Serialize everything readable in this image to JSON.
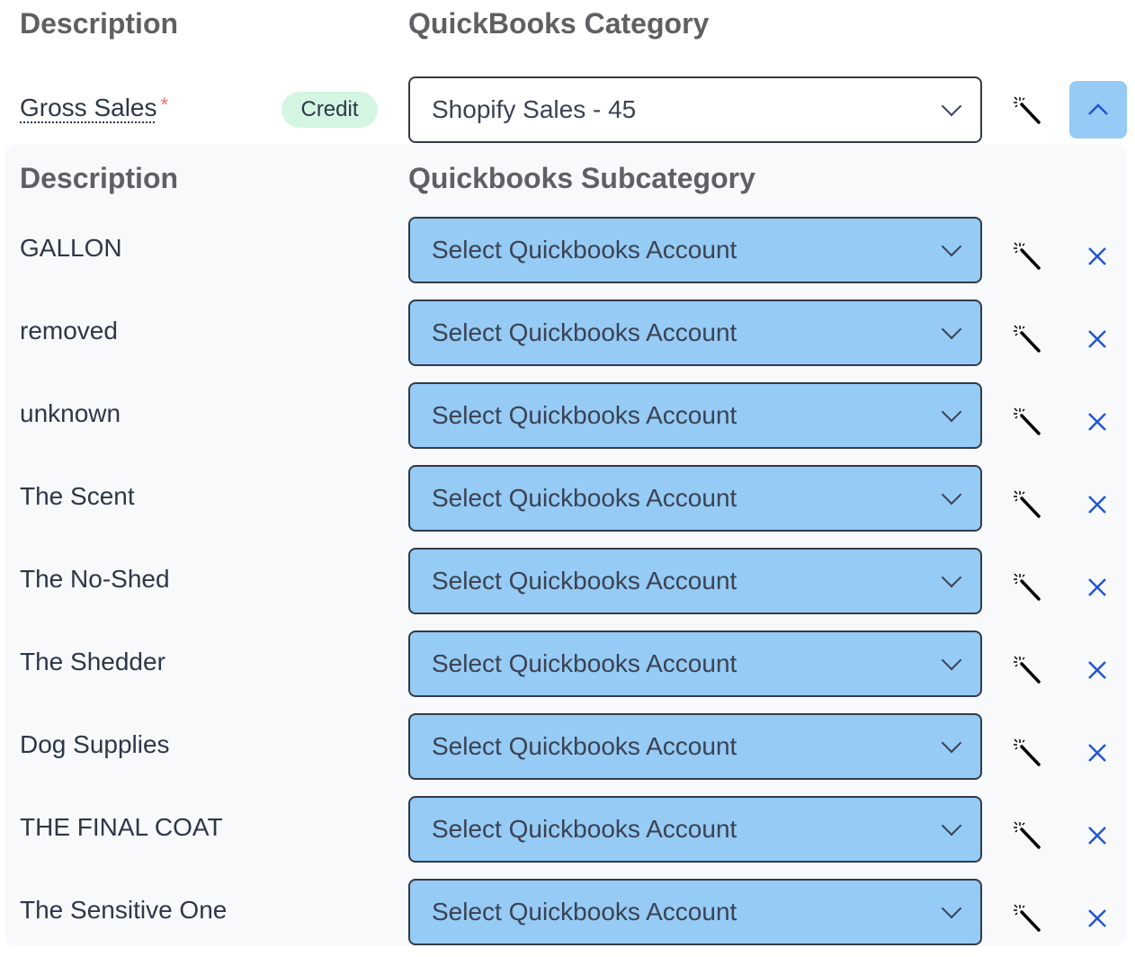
{
  "header": {
    "description_label": "Description",
    "category_label": "QuickBooks Category"
  },
  "main_row": {
    "label": "Gross Sales",
    "required_mark": "*",
    "badge": "Credit",
    "category_value": "Shopify Sales - 45",
    "auto_map_icon": "magic-wand-icon",
    "collapse_icon": "chevron-up-icon"
  },
  "sub_panel": {
    "description_label": "Description",
    "subcategory_label": "Quickbooks Subcategory",
    "rows": [
      {
        "label": "GALLON",
        "value": "Select Quickbooks Account"
      },
      {
        "label": "removed",
        "value": "Select Quickbooks Account"
      },
      {
        "label": "unknown",
        "value": "Select Quickbooks Account"
      },
      {
        "label": "The Scent",
        "value": "Select Quickbooks Account"
      },
      {
        "label": "The No-Shed",
        "value": "Select Quickbooks Account"
      },
      {
        "label": "The Shedder",
        "value": "Select Quickbooks Account"
      },
      {
        "label": "Dog Supplies",
        "value": "Select Quickbooks Account"
      },
      {
        "label": "THE FINAL COAT",
        "value": "Select Quickbooks Account"
      },
      {
        "label": "The Sensitive One",
        "value": "Select Quickbooks Account"
      }
    ]
  },
  "colors": {
    "select_highlight": "#95cbf5",
    "badge_bg": "#d5f5e3",
    "remove_icon": "#2255d4",
    "required": "#e57373"
  }
}
